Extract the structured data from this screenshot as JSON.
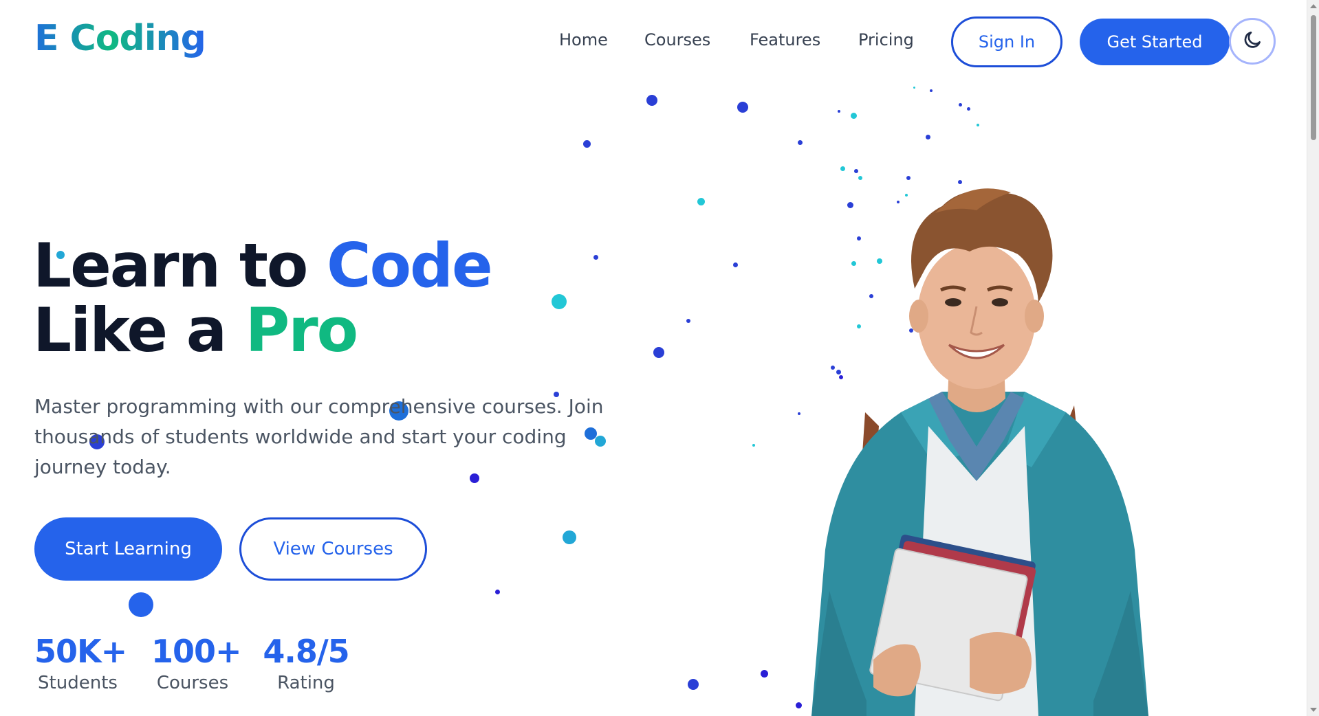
{
  "brand": {
    "logo_text": "E Coding"
  },
  "nav": {
    "items": [
      {
        "label": "Home"
      },
      {
        "label": "Courses"
      },
      {
        "label": "Features"
      },
      {
        "label": "Pricing"
      }
    ],
    "sign_in_label": "Sign In",
    "get_started_label": "Get Started",
    "theme_toggle_icon": "moon-icon"
  },
  "hero": {
    "title_line1_a": "Learn to ",
    "title_line1_b": "Code",
    "title_line2_a": "Like a ",
    "title_line2_b": "Pro",
    "description": "Master programming with our comprehensive courses. Join thousands of students worldwide and start your coding journey today.",
    "primary_cta": "Start Learning",
    "secondary_cta": "View Courses"
  },
  "stats": [
    {
      "value": "50K+",
      "label": "Students"
    },
    {
      "value": "100+",
      "label": "Courses"
    },
    {
      "value": "4.8/5",
      "label": "Rating"
    }
  ],
  "colors": {
    "primary": "#2563eb",
    "accent_green": "#10b981",
    "heading": "#0f172a",
    "body_text": "#4b5563",
    "particle_blue": "#2a3fd6",
    "particle_cyan": "#22c7d6"
  }
}
